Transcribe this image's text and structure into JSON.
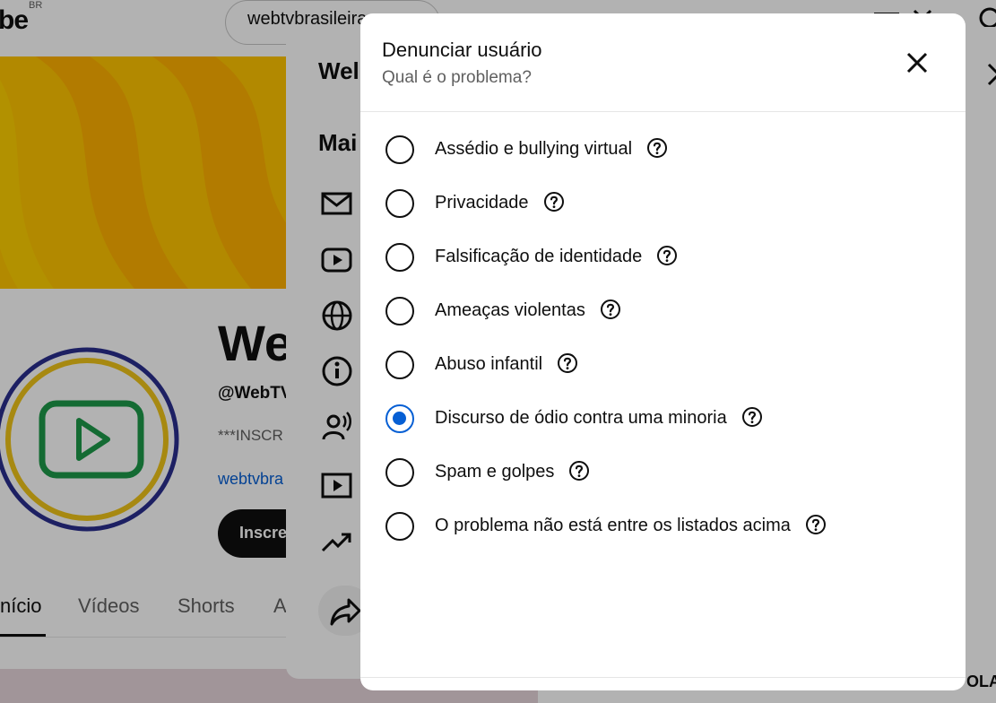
{
  "header": {
    "logo_text": "be",
    "logo_region": "BR",
    "search_value": "webtvbrasileira"
  },
  "channel": {
    "name": "We",
    "handle": "@WebTV",
    "description": "***INSCR",
    "link": "webtvbra",
    "subscribe_label": "Inscre"
  },
  "tabs": [
    {
      "label": "nício",
      "active": true
    },
    {
      "label": "Vídeos",
      "active": false
    },
    {
      "label": "Shorts",
      "active": false
    },
    {
      "label": "A",
      "active": false
    }
  ],
  "about_panel": {
    "title": "Wel",
    "section": "Mai",
    "corner_text": "OLA"
  },
  "dialog": {
    "title": "Denunciar usuário",
    "subtitle": "Qual é o problema?",
    "options": [
      {
        "label": "Assédio e bullying virtual",
        "selected": false
      },
      {
        "label": "Privacidade",
        "selected": false
      },
      {
        "label": "Falsificação de identidade",
        "selected": false
      },
      {
        "label": "Ameaças violentas",
        "selected": false
      },
      {
        "label": "Abuso infantil",
        "selected": false
      },
      {
        "label": "Discurso de ódio contra uma minoria",
        "selected": true
      },
      {
        "label": "Spam e golpes",
        "selected": false
      },
      {
        "label": "O problema não está entre os listados acima",
        "selected": false
      }
    ]
  },
  "colors": {
    "accent": "#065fd4",
    "banner": "#ffc400",
    "avatar_ring_outer": "#2a2f8f",
    "avatar_ring_inner": "#f0c419",
    "avatar_play": "#1e9a4a"
  },
  "icons": [
    "close-icon",
    "help-icon",
    "mail-icon",
    "youtube-icon",
    "globe-icon",
    "info-icon",
    "podcast-icon",
    "video-icon",
    "trending-icon",
    "share-icon"
  ]
}
